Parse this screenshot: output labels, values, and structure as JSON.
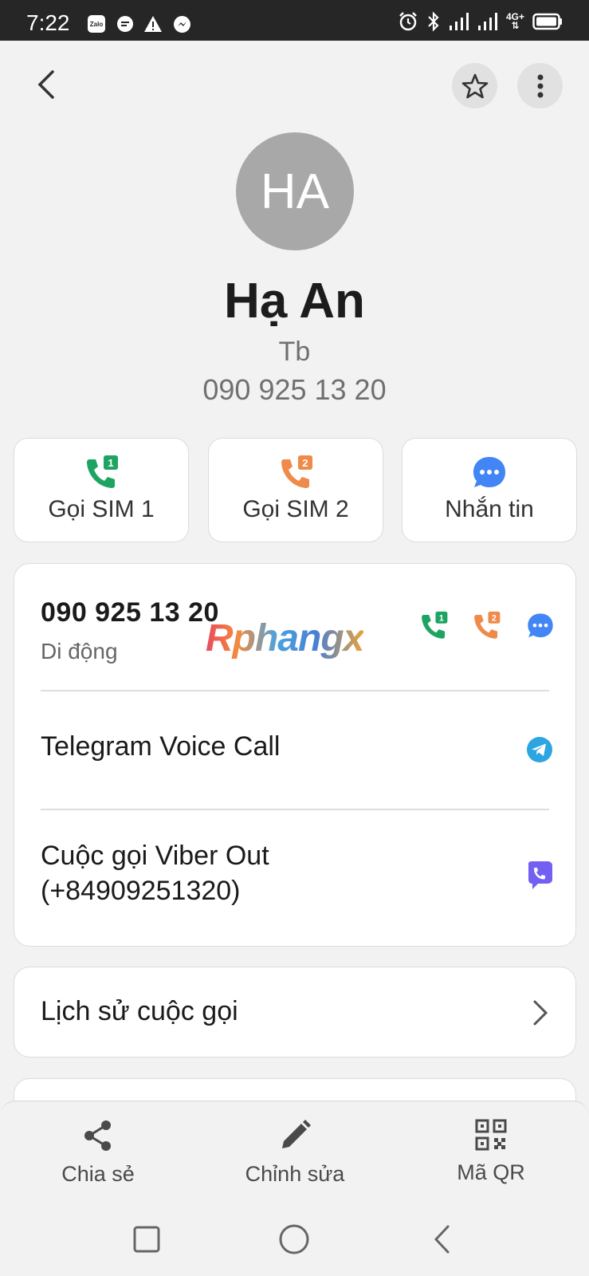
{
  "status_bar": {
    "time": "7:22",
    "apps": [
      "Zalo",
      "chat",
      "warning",
      "messenger"
    ],
    "network": "4G+",
    "icons": [
      "alarm-icon",
      "bluetooth-icon",
      "signal-icon",
      "signal-icon",
      "battery-icon"
    ]
  },
  "contact": {
    "initials": "HA",
    "name": "Hạ An",
    "label": "Tb",
    "phone": "090 925 13 20"
  },
  "quick_actions": [
    {
      "label": "Gọi SIM 1",
      "icon": "call-sim1-icon",
      "color": "#1da462"
    },
    {
      "label": "Gọi SIM 2",
      "icon": "call-sim2-icon",
      "color": "#f08a4b"
    },
    {
      "label": "Nhắn tin",
      "icon": "message-icon",
      "color": "#4285f4"
    }
  ],
  "details": {
    "phone_number": "090 925 13 20",
    "phone_type": "Di động",
    "telegram": "Telegram Voice Call",
    "viber_line1": "Cuộc gọi Viber Out",
    "viber_line2": "(+84909251320)"
  },
  "history": {
    "label": "Lịch sử cuộc gọi"
  },
  "watermark": "Rphangx",
  "bottom_actions": [
    {
      "label": "Chia sẻ",
      "icon": "share-icon"
    },
    {
      "label": "Chỉnh sửa",
      "icon": "edit-icon"
    },
    {
      "label": "Mã QR",
      "icon": "qr-code-icon"
    }
  ],
  "colors": {
    "sim1": "#1da462",
    "sim2": "#f08a4b",
    "message": "#4285f4",
    "telegram": "#2ca5e0",
    "viber": "#7360f2"
  }
}
